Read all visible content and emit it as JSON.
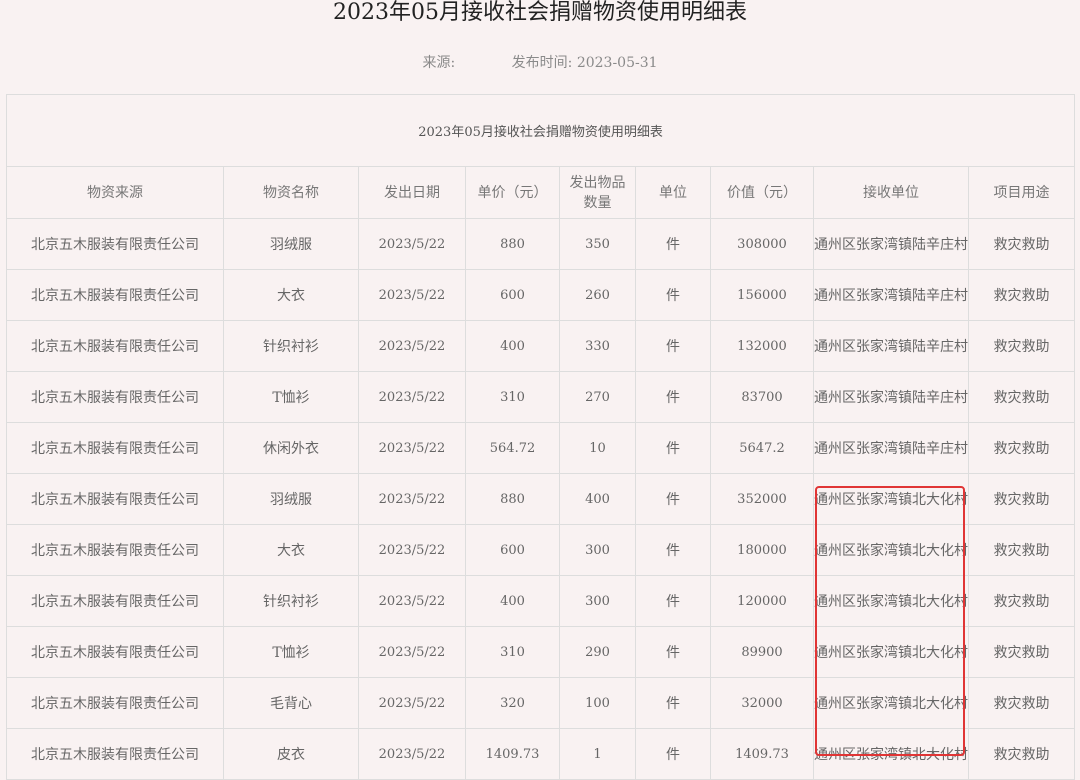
{
  "page": {
    "title": "2023年05月接收社会捐赠物资使用明细表",
    "source_label": "来源:",
    "publish_label": "发布时间:",
    "publish_date": "2023-05-31"
  },
  "table": {
    "caption": "2023年05月接收社会捐赠物资使用明细表",
    "headers": [
      "物资来源",
      "物资名称",
      "发出日期",
      "单价（元）",
      "发出物品数量",
      "单位",
      "价值（元）",
      "接收单位",
      "项目用途"
    ],
    "rows": [
      [
        "北京五木服装有限责任公司",
        "羽绒服",
        "2023/5/22",
        "880",
        "350",
        "件",
        "308000",
        "通州区张家湾镇陆辛庄村",
        "救灾救助"
      ],
      [
        "北京五木服装有限责任公司",
        "大衣",
        "2023/5/22",
        "600",
        "260",
        "件",
        "156000",
        "通州区张家湾镇陆辛庄村",
        "救灾救助"
      ],
      [
        "北京五木服装有限责任公司",
        "针织衬衫",
        "2023/5/22",
        "400",
        "330",
        "件",
        "132000",
        "通州区张家湾镇陆辛庄村",
        "救灾救助"
      ],
      [
        "北京五木服装有限责任公司",
        "T恤衫",
        "2023/5/22",
        "310",
        "270",
        "件",
        "83700",
        "通州区张家湾镇陆辛庄村",
        "救灾救助"
      ],
      [
        "北京五木服装有限责任公司",
        "休闲外衣",
        "2023/5/22",
        "564.72",
        "10",
        "件",
        "5647.2",
        "通州区张家湾镇陆辛庄村",
        "救灾救助"
      ],
      [
        "北京五木服装有限责任公司",
        "羽绒服",
        "2023/5/22",
        "880",
        "400",
        "件",
        "352000",
        "通州区张家湾镇北大化村",
        "救灾救助"
      ],
      [
        "北京五木服装有限责任公司",
        "大衣",
        "2023/5/22",
        "600",
        "300",
        "件",
        "180000",
        "通州区张家湾镇北大化村",
        "救灾救助"
      ],
      [
        "北京五木服装有限责任公司",
        "针织衬衫",
        "2023/5/22",
        "400",
        "300",
        "件",
        "120000",
        "通州区张家湾镇北大化村",
        "救灾救助"
      ],
      [
        "北京五木服装有限责任公司",
        "T恤衫",
        "2023/5/22",
        "310",
        "290",
        "件",
        "89900",
        "通州区张家湾镇北大化村",
        "救灾救助"
      ],
      [
        "北京五木服装有限责任公司",
        "毛背心",
        "2023/5/22",
        "320",
        "100",
        "件",
        "32000",
        "通州区张家湾镇北大化村",
        "救灾救助"
      ],
      [
        "北京五木服装有限责任公司",
        "皮衣",
        "2023/5/22",
        "1409.73",
        "1",
        "件",
        "1409.73",
        "通州区张家湾镇北大化村",
        "救灾救助"
      ]
    ]
  },
  "colors": {
    "background": "#f9f2f2",
    "highlight_border": "#e03535"
  }
}
